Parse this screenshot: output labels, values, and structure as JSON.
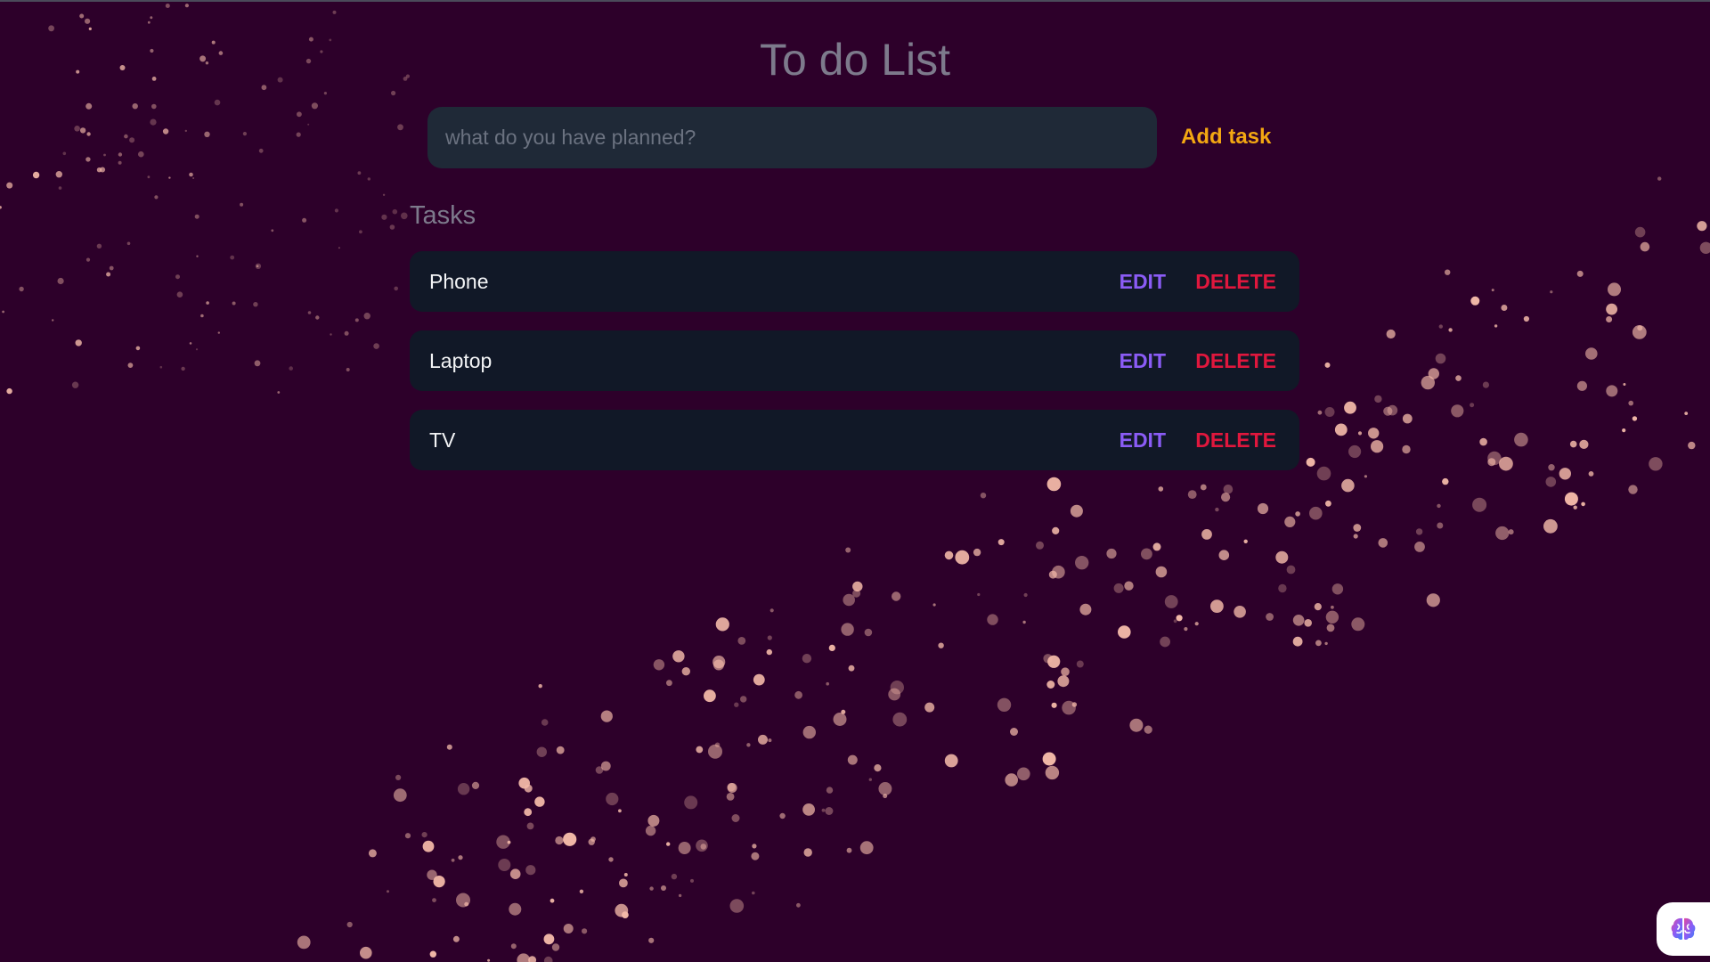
{
  "app": {
    "title": "To do List"
  },
  "input": {
    "placeholder": "what do you have planned?",
    "value": ""
  },
  "add_button": {
    "label": "Add task"
  },
  "tasks_section": {
    "heading": "Tasks",
    "items": [
      {
        "name": "Phone",
        "edit_label": "EDIT",
        "delete_label": "DELETE"
      },
      {
        "name": "Laptop",
        "edit_label": "EDIT",
        "delete_label": "DELETE"
      },
      {
        "name": "TV",
        "edit_label": "EDIT",
        "delete_label": "DELETE"
      }
    ]
  },
  "corner_widget": {
    "icon": "brain-icon"
  },
  "colors": {
    "background": "#2d002a",
    "accent_add": "#f3a712",
    "edit": "#8b5cf6",
    "delete": "#e0173d",
    "card": "#111827",
    "input": "#1f2937",
    "particle": "#f2b8a8"
  }
}
